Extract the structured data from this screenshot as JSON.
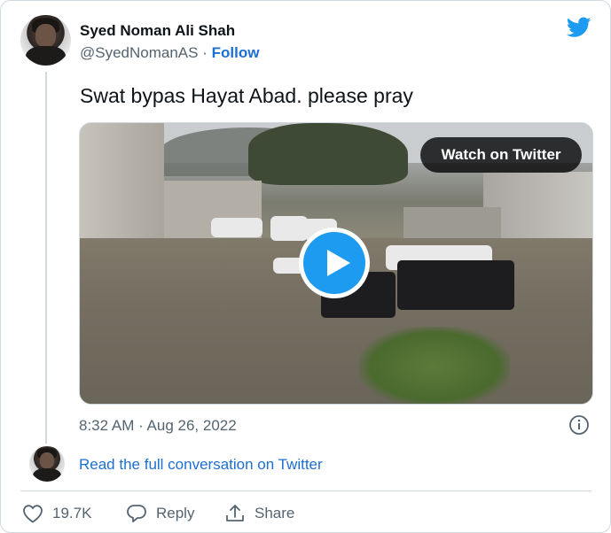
{
  "author": {
    "name": "Syed Noman Ali Shah",
    "handle": "@SyedNomanAS",
    "separator": "·",
    "follow_label": "Follow"
  },
  "tweet": {
    "text": "Swat bypas Hayat Abad. please pray",
    "timestamp": "8:32 AM · Aug 26, 2022"
  },
  "media": {
    "watch_label": "Watch on Twitter",
    "play_icon": "play-icon"
  },
  "conversation_link": "Read the full conversation on Twitter",
  "actions": {
    "like_count": "19.7K",
    "reply_label": "Reply",
    "share_label": "Share"
  },
  "colors": {
    "twitter_blue": "#1d9bf0",
    "link_blue": "#1d6fd1",
    "muted_text": "#536471",
    "border": "#cfd9de"
  },
  "icons": [
    "twitter-bird-icon",
    "info-icon",
    "heart-icon",
    "reply-icon",
    "share-icon",
    "play-icon"
  ]
}
